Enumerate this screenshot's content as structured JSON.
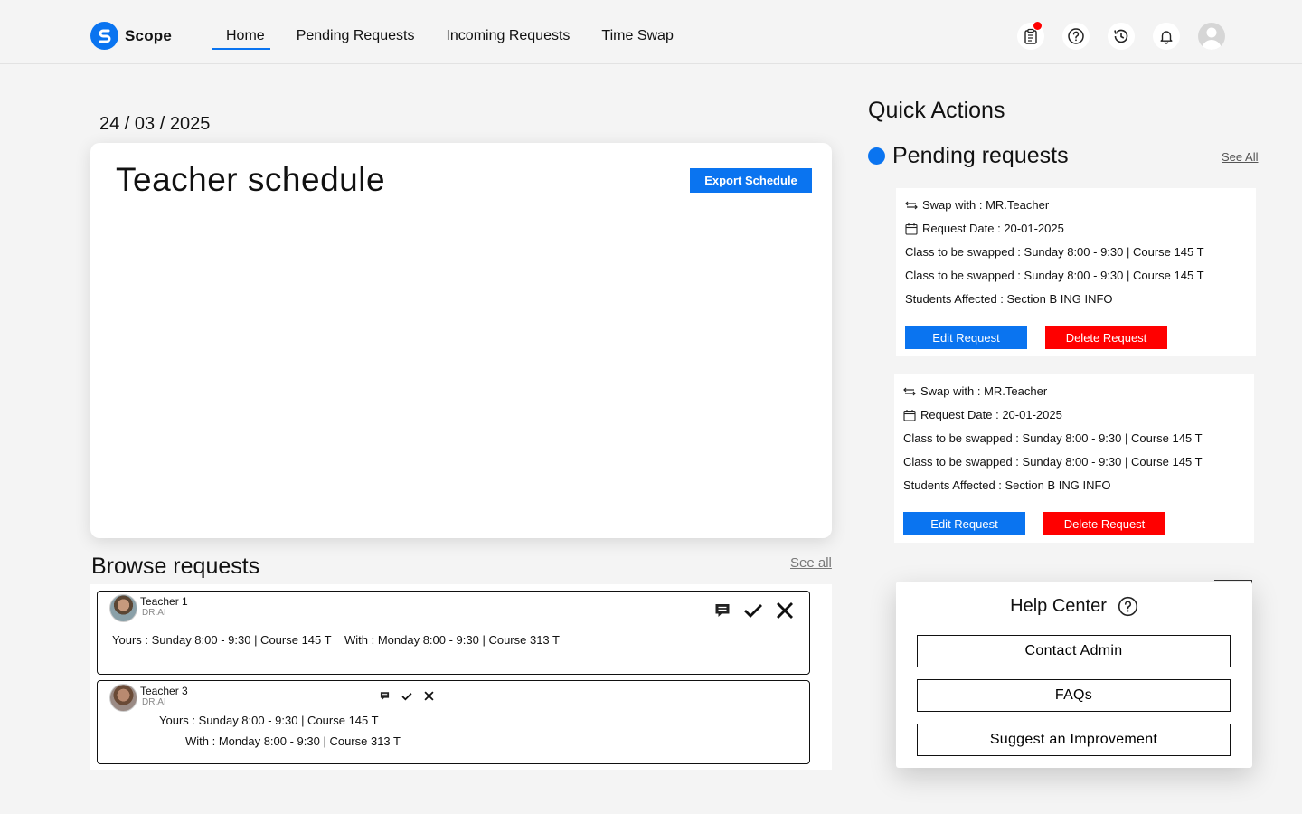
{
  "app": {
    "brand": "Scope"
  },
  "nav": {
    "items": [
      {
        "label": "Home",
        "active": true
      },
      {
        "label": "Pending Requests",
        "active": false
      },
      {
        "label": "Incoming Requests",
        "active": false
      },
      {
        "label": "Time Swap",
        "active": false
      }
    ]
  },
  "header_icons": [
    "clipboard-icon",
    "help-icon",
    "history-icon",
    "bell-icon",
    "user-avatar"
  ],
  "date": "24 / 03 / 2025",
  "schedule": {
    "title": "Teacher schedule",
    "export_label": "Export Schedule"
  },
  "browse": {
    "title": "Browse requests",
    "see_all": "See all",
    "requests": [
      {
        "name": "Teacher 1",
        "subtitle": "DR.AI",
        "yours": "Yours : Sunday 8:00 - 9:30 | Course 145 T",
        "with": "With : Monday 8:00 - 9:30 | Course 313 T"
      },
      {
        "name": "Teacher 3",
        "subtitle": "DR.AI",
        "yours": "Yours : Sunday 8:00 - 9:30 | Course 145 T",
        "with": "With : Monday 8:00 - 9:30 | Course 313 T"
      }
    ]
  },
  "quick_actions": {
    "title": "Quick Actions",
    "pending_title": "Pending requests",
    "see_all": "See All",
    "cards": [
      {
        "swap_with": "Swap with : MR.Teacher",
        "request_date": "Request Date : 20-01-2025",
        "class_1": "Class to be swapped : Sunday 8:00 - 9:30 | Course 145 T",
        "class_2": "Class to be swapped : Sunday 8:00 - 9:30 | Course 145 T",
        "students": "Students Affected : Section B ING INFO",
        "edit_label": "Edit Request",
        "delete_label": "Delete Request"
      },
      {
        "swap_with": "Swap with : MR.Teacher",
        "request_date": "Request Date : 20-01-2025",
        "class_1": "Class to be swapped : Sunday 8:00 - 9:30 | Course 145 T",
        "class_2": "Class to be swapped : Sunday 8:00 - 9:30 | Course 145 T",
        "students": "Students Affected : Section B ING INFO",
        "edit_label": "Edit Request",
        "delete_label": "Delete Request"
      }
    ]
  },
  "help_center": {
    "title": "Help Center",
    "buttons": [
      "Contact Admin",
      "FAQs",
      "Suggest an Improvement"
    ]
  },
  "colors": {
    "accent": "#0a74f0",
    "danger": "#ff0000"
  }
}
